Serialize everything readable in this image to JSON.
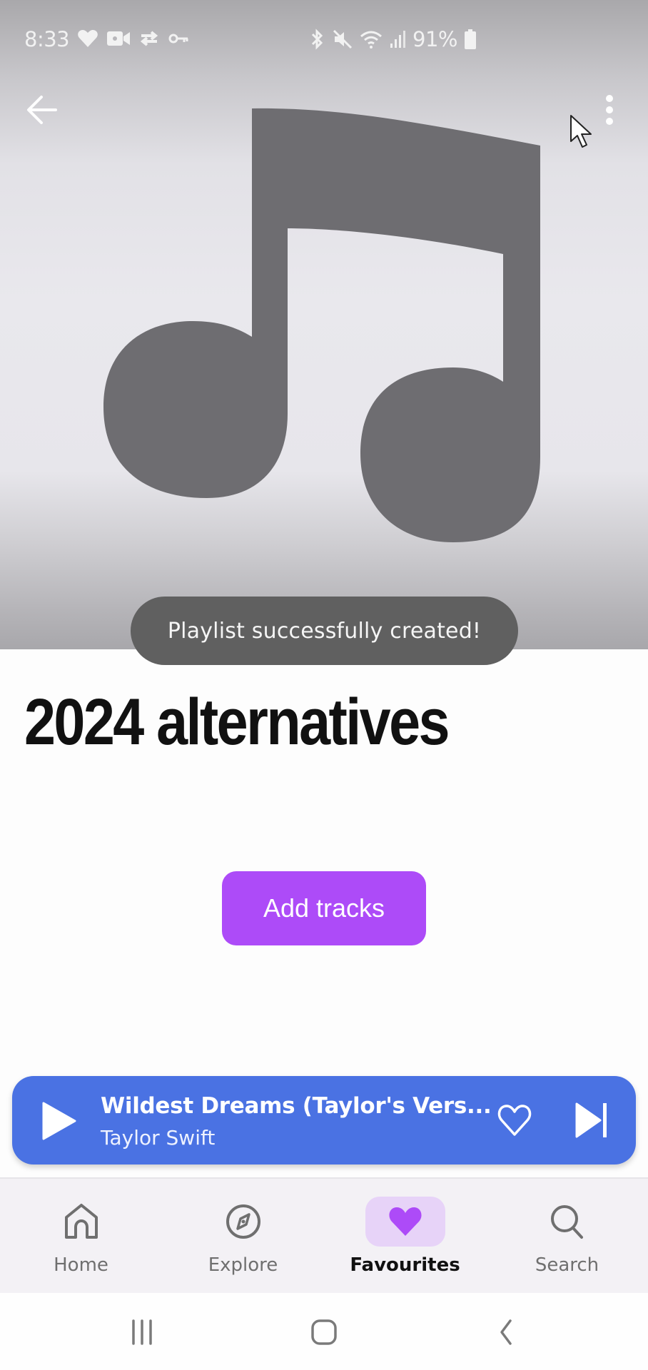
{
  "status_bar": {
    "time": "8:33",
    "left_icons": [
      "heart-health-icon",
      "video-camera-icon",
      "sync-icon",
      "vpn-key-icon"
    ],
    "right_icons": [
      "bluetooth-icon",
      "mute-icon",
      "wifi-icon",
      "signal-icon"
    ],
    "battery_percent": "91%"
  },
  "header": {
    "back_icon": "arrow-left-icon",
    "more_icon": "more-vertical-icon",
    "artwork_icon": "music-note-icon"
  },
  "toast": {
    "message": "Playlist successfully created!"
  },
  "playlist": {
    "title": "2024 alternatives",
    "add_tracks_label": "Add tracks"
  },
  "mini_player": {
    "track_title": "Wildest Dreams (Taylor's Vers...",
    "artist": "Taylor Swift",
    "play_icon": "play-icon",
    "like_icon": "heart-outline-icon",
    "next_icon": "skip-next-icon",
    "background_color": "#4a72e3"
  },
  "bottom_nav": {
    "active": "Favourites",
    "items": [
      {
        "label": "Home",
        "icon": "home-icon"
      },
      {
        "label": "Explore",
        "icon": "compass-icon"
      },
      {
        "label": "Favourites",
        "icon": "heart-icon"
      },
      {
        "label": "Search",
        "icon": "search-icon"
      }
    ],
    "accent_color": "#ad4bf8"
  },
  "system_nav": {
    "buttons": [
      "recent-apps",
      "home",
      "back"
    ]
  }
}
